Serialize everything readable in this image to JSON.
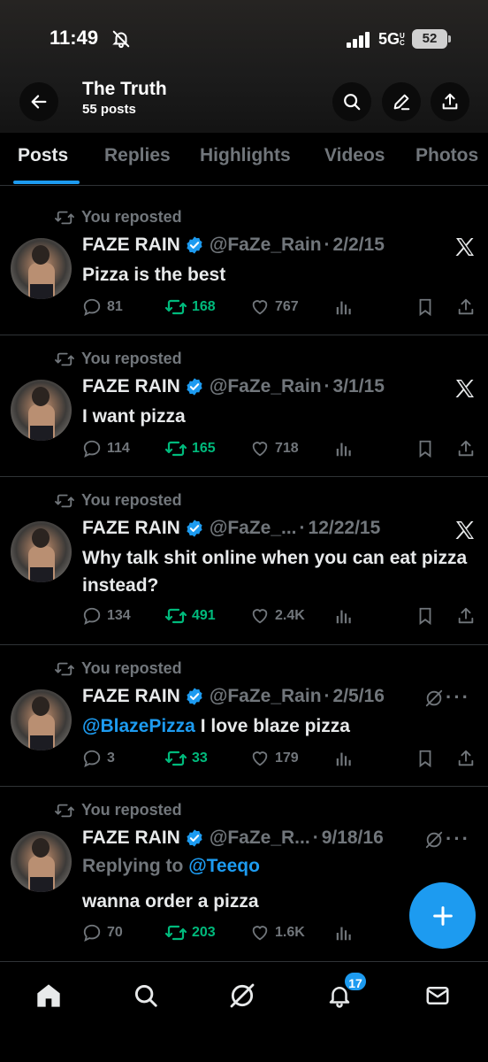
{
  "status_bar": {
    "time": "11:49",
    "network": "5G",
    "network_suffix": "UC",
    "battery": "52"
  },
  "header": {
    "title": "The Truth",
    "subtitle": "55 posts"
  },
  "tabs": [
    {
      "label": "Posts",
      "active": true
    },
    {
      "label": "Replies"
    },
    {
      "label": "Highlights"
    },
    {
      "label": "Videos"
    },
    {
      "label": "Photos"
    }
  ],
  "posts": [
    {
      "repost_label": "You reposted",
      "name": "FAZE RAIN",
      "handle": "@FaZe_Rain",
      "date": "2/2/15",
      "text": "Pizza is the best",
      "replies": "81",
      "reposts": "168",
      "likes": "767",
      "source_icon": "x-logo-icon"
    },
    {
      "repost_label": "You reposted",
      "name": "FAZE RAIN",
      "handle": "@FaZe_Rain",
      "date": "3/1/15",
      "text": "I want pizza",
      "replies": "114",
      "reposts": "165",
      "likes": "718",
      "source_icon": "x-logo-icon"
    },
    {
      "repost_label": "You reposted",
      "name": "FAZE RAIN",
      "handle": "@FaZe_...",
      "date": "12/22/15",
      "text": "Why talk shit online when you can eat pizza instead?",
      "replies": "134",
      "reposts": "491",
      "likes": "2.4K",
      "source_icon": "x-logo-icon"
    },
    {
      "repost_label": "You reposted",
      "name": "FAZE RAIN",
      "handle": "@FaZe_Rain",
      "date": "2/5/16",
      "mention": "@BlazePizza",
      "text": "I love blaze pizza",
      "replies": "3",
      "reposts": "33",
      "likes": "179",
      "source_icon": "grok-icon"
    },
    {
      "repost_label": "You reposted",
      "name": "FAZE RAIN",
      "handle": "@FaZe_R...",
      "date": "9/18/16",
      "reply_prefix": "Replying to",
      "reply_mention": "@Teeqo",
      "text": "wanna order a pizza",
      "replies": "70",
      "reposts": "203",
      "likes": "1.6K",
      "source_icon": "grok-icon"
    }
  ],
  "bottom_nav": {
    "notifications_badge": "17"
  },
  "colors": {
    "accent": "#1d9bf0",
    "repost_green": "#00ba7c",
    "muted": "#71767b",
    "text": "#e7e9ea",
    "divider": "#2f3336"
  }
}
